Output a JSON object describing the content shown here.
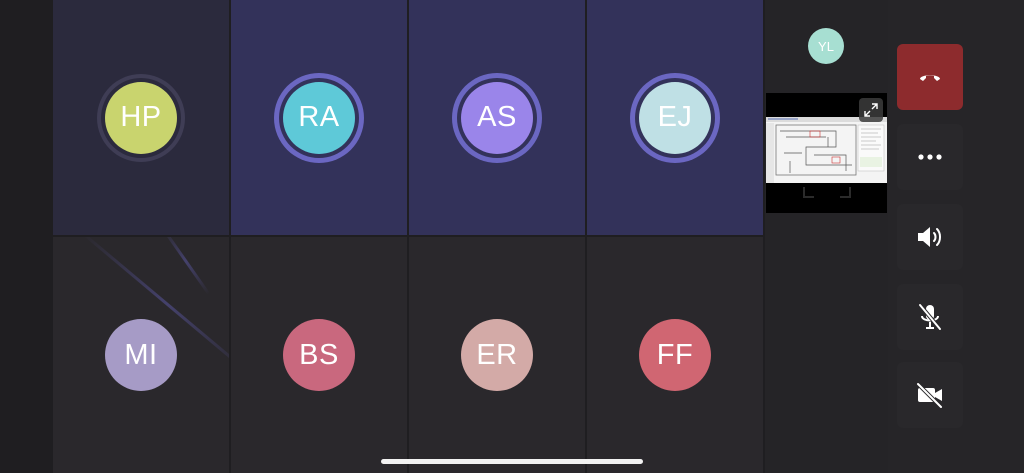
{
  "participants": [
    {
      "initials": "HP",
      "color": "#c9d46e",
      "speaking": false
    },
    {
      "initials": "RA",
      "color": "#5ec9d8",
      "speaking": true
    },
    {
      "initials": "AS",
      "color": "#9a85ea",
      "speaking": true
    },
    {
      "initials": "EJ",
      "color": "#bfe0e5",
      "speaking": true
    },
    {
      "initials": "MI",
      "color": "#a69bc6",
      "speaking": false
    },
    {
      "initials": "BS",
      "color": "#c9687e",
      "speaking": false
    },
    {
      "initials": "ER",
      "color": "#d3aaa7",
      "speaking": false
    },
    {
      "initials": "FF",
      "color": "#d06672",
      "speaking": false
    }
  ],
  "self": {
    "initials": "YL",
    "color": "#a7dfd2"
  },
  "controls": {
    "hangup_icon": "phone-hangup-icon",
    "more_icon": "more-icon",
    "speaker_icon": "speaker-icon",
    "mic_icon": "mic-off-icon",
    "camera_icon": "camera-off-icon"
  },
  "colors": {
    "hangup": "#8d2b2d",
    "active_tile": "#33325a",
    "speaking_ring": "#6b67c2"
  }
}
